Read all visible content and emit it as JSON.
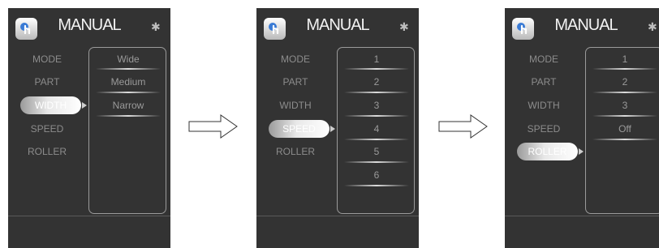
{
  "screens": [
    {
      "title": "MANUAL",
      "menu": [
        {
          "label": "MODE",
          "selected": false
        },
        {
          "label": "PART",
          "selected": false
        },
        {
          "label": "WIDTH",
          "selected": true
        },
        {
          "label": "SPEED",
          "selected": false
        },
        {
          "label": "ROLLER",
          "selected": false
        }
      ],
      "options": [
        "Wide",
        "Medium",
        "Narrow"
      ]
    },
    {
      "title": "MANUAL",
      "menu": [
        {
          "label": "MODE",
          "selected": false
        },
        {
          "label": "PART",
          "selected": false
        },
        {
          "label": "WIDTH",
          "selected": false
        },
        {
          "label": "SPEED",
          "selected": true
        },
        {
          "label": "ROLLER",
          "selected": false
        }
      ],
      "options": [
        "1",
        "2",
        "3",
        "4",
        "5",
        "6"
      ]
    },
    {
      "title": "MANUAL",
      "menu": [
        {
          "label": "MODE",
          "selected": false
        },
        {
          "label": "PART",
          "selected": false
        },
        {
          "label": "WIDTH",
          "selected": false
        },
        {
          "label": "SPEED",
          "selected": false
        },
        {
          "label": "ROLLER",
          "selected": true
        }
      ],
      "options": [
        "1",
        "2",
        "3",
        "Off"
      ]
    }
  ],
  "icons": {
    "app": "hand-touch-icon",
    "status": "bluetooth-icon",
    "transition": "right-arrow-icon"
  },
  "colors": {
    "screen_bg": "#333333",
    "menu_text": "#8c8c8c",
    "selected_text": "#ffffff",
    "panel_border": "#9a9a9a"
  }
}
